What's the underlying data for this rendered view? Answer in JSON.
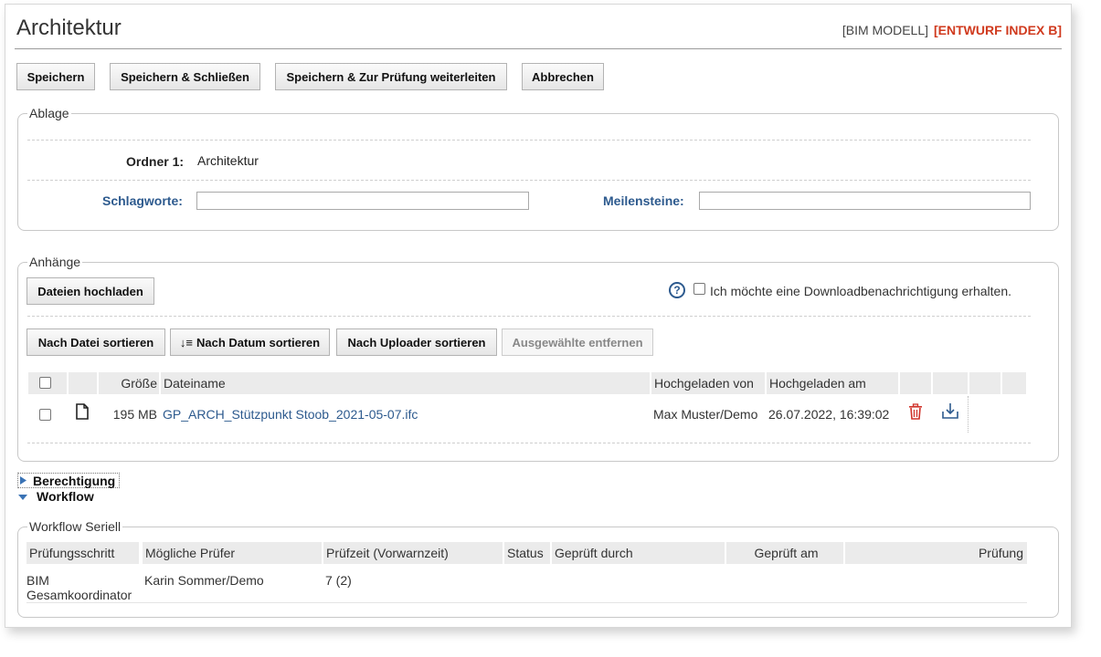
{
  "header": {
    "title": "Architektur",
    "tag_model": "[BIM MODELL]",
    "tag_status": "[ENTWURF INDEX B]"
  },
  "toolbar": {
    "save": "Speichern",
    "save_close": "Speichern & Schließen",
    "save_forward": "Speichern & Zur Prüfung weiterleiten",
    "cancel": "Abbrechen"
  },
  "ablage": {
    "legend": "Ablage",
    "folder_label": "Ordner 1:",
    "folder_value": "Architektur",
    "keywords_label": "Schlagworte:",
    "keywords_value": "",
    "milestones_label": "Meilensteine:",
    "milestones_value": ""
  },
  "attachments": {
    "legend": "Anhänge",
    "upload": "Dateien hochladen",
    "help_icon": "?",
    "notify_label": "Ich möchte eine Downloadbenachrichtigung erhalten.",
    "sort_file": "Nach Datei sortieren",
    "sort_date": "Nach Datum sortieren",
    "sort_date_icon": "↓≡",
    "sort_uploader": "Nach Uploader sortieren",
    "remove_selected": "Ausgewählte entfernen",
    "columns": {
      "size": "Größe",
      "filename": "Dateiname",
      "uploaded_by": "Hochgeladen von",
      "uploaded_at": "Hochgeladen am"
    },
    "rows": [
      {
        "icon": "file-icon",
        "size": "195 MB",
        "filename": "GP_ARCH_Stützpunkt Stoob_2021-05-07.ifc",
        "uploaded_by": "Max Muster/Demo",
        "uploaded_at": "26.07.2022, 16:39:02",
        "delete_icon": "trash-icon",
        "download_icon": "download-icon"
      }
    ]
  },
  "sections": {
    "permissions": "Berechtigung",
    "workflow": "Workflow"
  },
  "workflow": {
    "legend": "Workflow Seriell",
    "columns": {
      "step": "Prüfungsschritt",
      "reviewers": "Mögliche Prüfer",
      "time": "Prüfzeit (Vorwarnzeit)",
      "status": "Status",
      "checked_by": "Geprüft durch",
      "checked_at": "Geprüft am",
      "check": "Prüfung"
    },
    "rows": [
      {
        "step_line1": "BIM",
        "step_line2": "Gesamkoordinator",
        "reviewers": "Karin Sommer/Demo",
        "time": "7 (2)",
        "status": "",
        "checked_by": "",
        "checked_at": "",
        "check": ""
      }
    ]
  },
  "colors": {
    "accent_blue": "#2d5a8e",
    "status_red": "#d03a1e",
    "trash_red": "#d0322a"
  }
}
